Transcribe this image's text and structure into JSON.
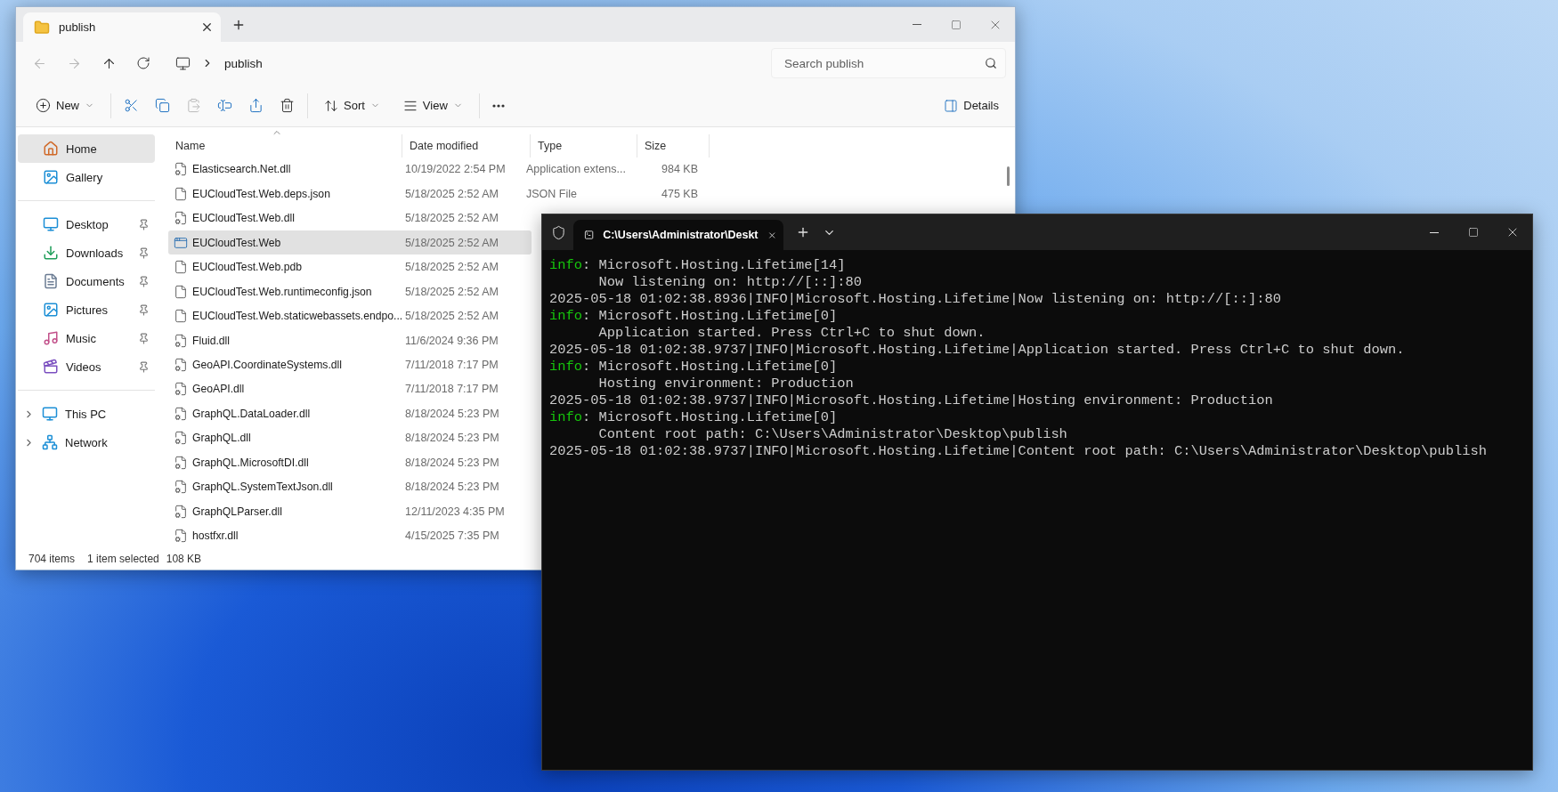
{
  "explorer": {
    "tab_title": "publish",
    "address": "publish",
    "search": {
      "placeholder": "Search publish"
    },
    "toolbar": {
      "new_label": "New",
      "paste_disabled": true,
      "sort_label": "Sort",
      "view_label": "View",
      "details_label": "Details"
    },
    "sidebar": {
      "groups": [
        {
          "items": [
            {
              "kind": "home",
              "label": "Home",
              "selected": true,
              "pinned": false
            },
            {
              "kind": "gallery",
              "label": "Gallery",
              "selected": false,
              "pinned": false
            }
          ]
        },
        {
          "items": [
            {
              "kind": "desktop",
              "label": "Desktop",
              "selected": false,
              "pinned": true
            },
            {
              "kind": "downloads",
              "label": "Downloads",
              "selected": false,
              "pinned": true
            },
            {
              "kind": "documents",
              "label": "Documents",
              "selected": false,
              "pinned": true
            },
            {
              "kind": "pictures",
              "label": "Pictures",
              "selected": false,
              "pinned": true
            },
            {
              "kind": "music",
              "label": "Music",
              "selected": false,
              "pinned": true
            },
            {
              "kind": "videos",
              "label": "Videos",
              "selected": false,
              "pinned": true
            }
          ]
        },
        {
          "items": [
            {
              "kind": "pc",
              "label": "This PC",
              "selected": false,
              "pinned": false,
              "expanded": false
            },
            {
              "kind": "network",
              "label": "Network",
              "selected": false,
              "pinned": false,
              "expanded": false
            }
          ]
        }
      ]
    },
    "table": {
      "columns": [
        "Name",
        "Date modified",
        "Type",
        "Size"
      ],
      "rows": [
        {
          "kind": "dll",
          "name": "Elasticsearch.Net.dll",
          "date": "10/19/2022 2:54 PM",
          "type": "Application extens...",
          "size": "984 KB",
          "selected": false
        },
        {
          "kind": "file",
          "name": "EUCloudTest.Web.deps.json",
          "date": "5/18/2025 2:52 AM",
          "type": "JSON File",
          "size": "475 KB",
          "selected": false
        },
        {
          "kind": "dll",
          "name": "EUCloudTest.Web.dll",
          "date": "5/18/2025 2:52 AM",
          "selected": false
        },
        {
          "kind": "app",
          "name": "EUCloudTest.Web",
          "date": "5/18/2025 2:52 AM",
          "selected": true
        },
        {
          "kind": "file",
          "name": "EUCloudTest.Web.pdb",
          "date": "5/18/2025 2:52 AM",
          "selected": false
        },
        {
          "kind": "file",
          "name": "EUCloudTest.Web.runtimeconfig.json",
          "date": "5/18/2025 2:52 AM",
          "selected": false
        },
        {
          "kind": "file",
          "name": "EUCloudTest.Web.staticwebassets.endpo...",
          "date": "5/18/2025 2:52 AM",
          "selected": false
        },
        {
          "kind": "dll",
          "name": "Fluid.dll",
          "date": "11/6/2024 9:36 PM",
          "selected": false
        },
        {
          "kind": "dll",
          "name": "GeoAPI.CoordinateSystems.dll",
          "date": "7/11/2018 7:17 PM",
          "selected": false
        },
        {
          "kind": "dll",
          "name": "GeoAPI.dll",
          "date": "7/11/2018 7:17 PM",
          "selected": false
        },
        {
          "kind": "dll",
          "name": "GraphQL.DataLoader.dll",
          "date": "8/18/2024 5:23 PM",
          "selected": false
        },
        {
          "kind": "dll",
          "name": "GraphQL.dll",
          "date": "8/18/2024 5:23 PM",
          "selected": false
        },
        {
          "kind": "dll",
          "name": "GraphQL.MicrosoftDI.dll",
          "date": "8/18/2024 5:23 PM",
          "selected": false
        },
        {
          "kind": "dll",
          "name": "GraphQL.SystemTextJson.dll",
          "date": "8/18/2024 5:23 PM",
          "selected": false
        },
        {
          "kind": "dll",
          "name": "GraphQLParser.dll",
          "date": "12/11/2023 4:35 PM",
          "selected": false
        },
        {
          "kind": "dll",
          "name": "hostfxr.dll",
          "date": "4/15/2025 7:35 PM",
          "selected": false
        }
      ]
    },
    "status_bar": {
      "count": "704 items",
      "selection": "1 item selected",
      "size": "108 KB"
    }
  },
  "terminal": {
    "tab_title": "C:\\Users\\Administrator\\Deskt",
    "lines": [
      {
        "kind": "info",
        "level": "info",
        "text": ": Microsoft.Hosting.Lifetime[14]"
      },
      {
        "kind": "plain",
        "text": "      Now listening on: http://[::]:80"
      },
      {
        "kind": "plain",
        "text": "2025-05-18 01:02:38.8936|INFO|Microsoft.Hosting.Lifetime|Now listening on: http://[::]:80"
      },
      {
        "kind": "info",
        "level": "info",
        "text": ": Microsoft.Hosting.Lifetime[0]"
      },
      {
        "kind": "plain",
        "text": "      Application started. Press Ctrl+C to shut down."
      },
      {
        "kind": "plain",
        "text": "2025-05-18 01:02:38.9737|INFO|Microsoft.Hosting.Lifetime|Application started. Press Ctrl+C to shut down."
      },
      {
        "kind": "info",
        "level": "info",
        "text": ": Microsoft.Hosting.Lifetime[0]"
      },
      {
        "kind": "plain",
        "text": "      Hosting environment: Production"
      },
      {
        "kind": "plain",
        "text": "2025-05-18 01:02:38.9737|INFO|Microsoft.Hosting.Lifetime|Hosting environment: Production"
      },
      {
        "kind": "info",
        "level": "info",
        "text": ": Microsoft.Hosting.Lifetime[0]"
      },
      {
        "kind": "plain",
        "text": "      Content root path: C:\\Users\\Administrator\\Desktop\\publish"
      },
      {
        "kind": "plain",
        "text": "2025-05-18 01:02:38.9737|INFO|Microsoft.Hosting.Lifetime|Content root path: C:\\Users\\Administrator\\Desktop\\publish"
      }
    ]
  }
}
